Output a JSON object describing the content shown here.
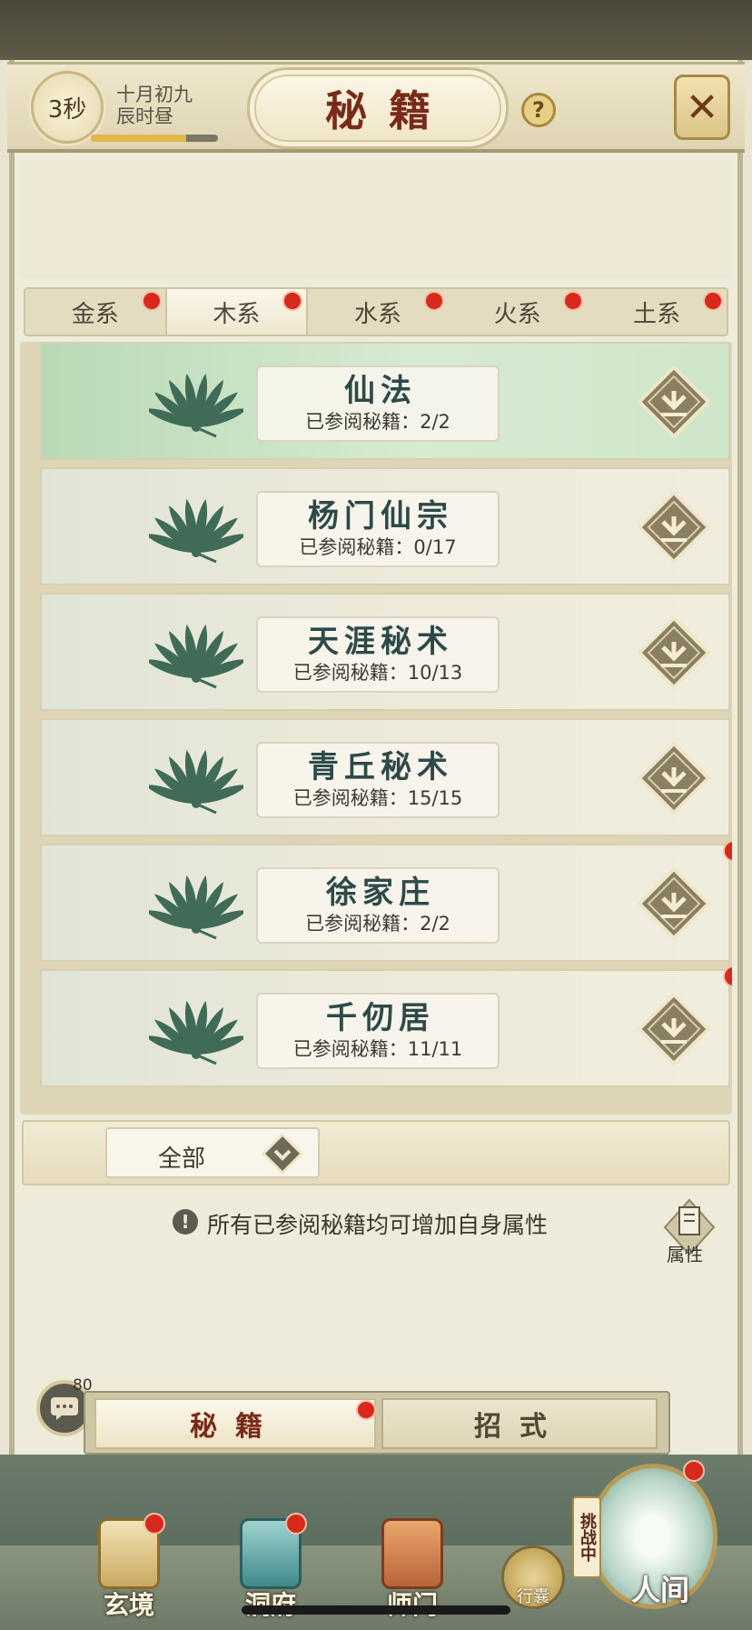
{
  "header": {
    "timer": "3秒",
    "date_line1": "十月初九",
    "date_line2": "辰时昼",
    "time_progress": 0.75,
    "title": "秘籍",
    "help_icon": "question-icon",
    "close_icon": "close-icon"
  },
  "tabs": [
    {
      "label": "金系",
      "active": false,
      "badge": true
    },
    {
      "label": "木系",
      "active": true,
      "badge": true
    },
    {
      "label": "水系",
      "active": false,
      "badge": true
    },
    {
      "label": "火系",
      "active": false,
      "badge": true
    },
    {
      "label": "土系",
      "active": false,
      "badge": true
    }
  ],
  "progress_prefix": "已参阅秘籍：",
  "sects": [
    {
      "name": "仙法",
      "progress": "2/2",
      "active": true,
      "badge": false
    },
    {
      "name": "杨门仙宗",
      "progress": "0/17",
      "active": false,
      "badge": false
    },
    {
      "name": "天涯秘术",
      "progress": "10/13",
      "active": false,
      "badge": false
    },
    {
      "name": "青丘秘术",
      "progress": "15/15",
      "active": false,
      "badge": false
    },
    {
      "name": "徐家庄",
      "progress": "2/2",
      "active": false,
      "badge": true
    },
    {
      "name": "千仞居",
      "progress": "11/11",
      "active": false,
      "badge": true
    }
  ],
  "filter": {
    "label": "全部"
  },
  "info": {
    "text": "所有已参阅秘籍均可增加自身属性",
    "attr_label": "属性"
  },
  "chat": {
    "count": "80"
  },
  "subtabs": [
    {
      "label": "秘籍",
      "active": true,
      "badge": true
    },
    {
      "label": "招式",
      "active": false,
      "badge": false
    }
  ],
  "nav": {
    "items": [
      {
        "label": "玄境",
        "badge": true
      },
      {
        "label": "洞府",
        "badge": true
      },
      {
        "label": "师门",
        "badge": false
      }
    ],
    "bag_label": "行囊",
    "challenge": "挑战中",
    "world_label": "人间"
  },
  "colors": {
    "accent_red": "#d72a1c",
    "title_red": "#7a2a18",
    "sect_green": "#2e4a48"
  }
}
